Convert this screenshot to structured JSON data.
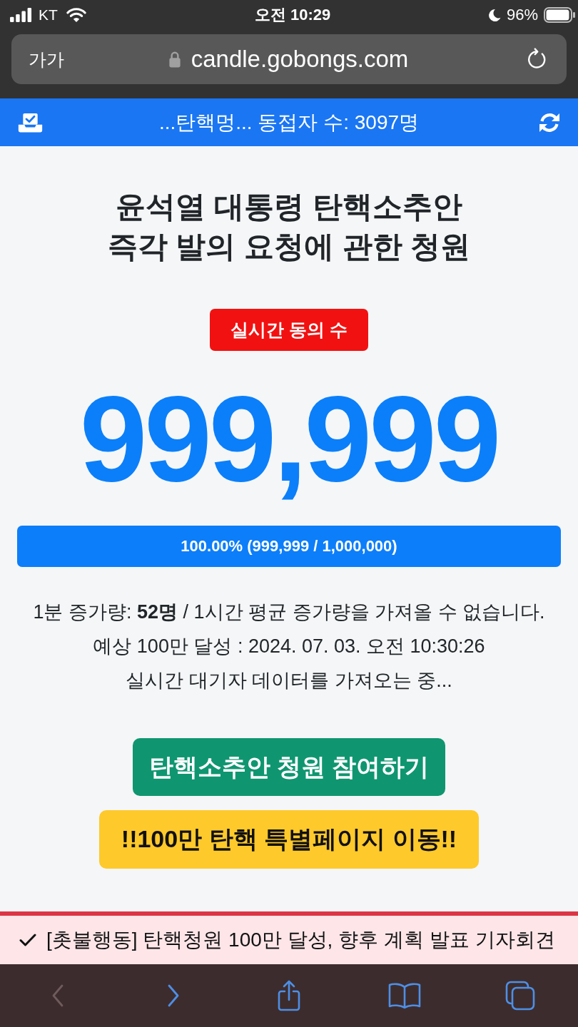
{
  "status_bar": {
    "carrier": "KT",
    "time": "오전 10:29",
    "battery_percent": "96%"
  },
  "address_bar": {
    "text_size_button": "가가",
    "url": "candle.gobongs.com"
  },
  "top_bar": {
    "text": "...탄핵멍... 동접자 수: 3097명"
  },
  "petition": {
    "title_lines": [
      "윤석열 대통령 탄핵소추안",
      "즉각 발의 요청에 관한 청원"
    ],
    "badge": "실시간 동의 수",
    "count": "999,999",
    "progress": {
      "level": 1.0,
      "label": "100.00% (999,999 / 1,000,000)"
    },
    "stats": [
      "1분 증가량: **52명** / 1시간 평균 증가량을 가져올 수 없습니다.",
      "예상 100만 달성 : 2024. 07. 03. 오전 10:30:26",
      "실시간 대기자 데이터를 가져오는 중..."
    ]
  },
  "buttons": [
    {
      "kind": "primary",
      "label": "탄핵소추안 청원 참여하기"
    },
    {
      "kind": "warning",
      "label": "!!100만 탄핵 특별페이지 이동!!"
    }
  ],
  "notice": {
    "text": "[촛불행동] 탄핵청원 100만 달성, 향후 계획 발표 기자회견"
  },
  "toolbar": [
    {
      "kind": "back",
      "disabled": true
    },
    {
      "kind": "forward",
      "disabled": false
    },
    {
      "kind": "share",
      "disabled": false
    },
    {
      "kind": "bookmarks",
      "disabled": false
    },
    {
      "kind": "tabs",
      "disabled": false
    }
  ]
}
